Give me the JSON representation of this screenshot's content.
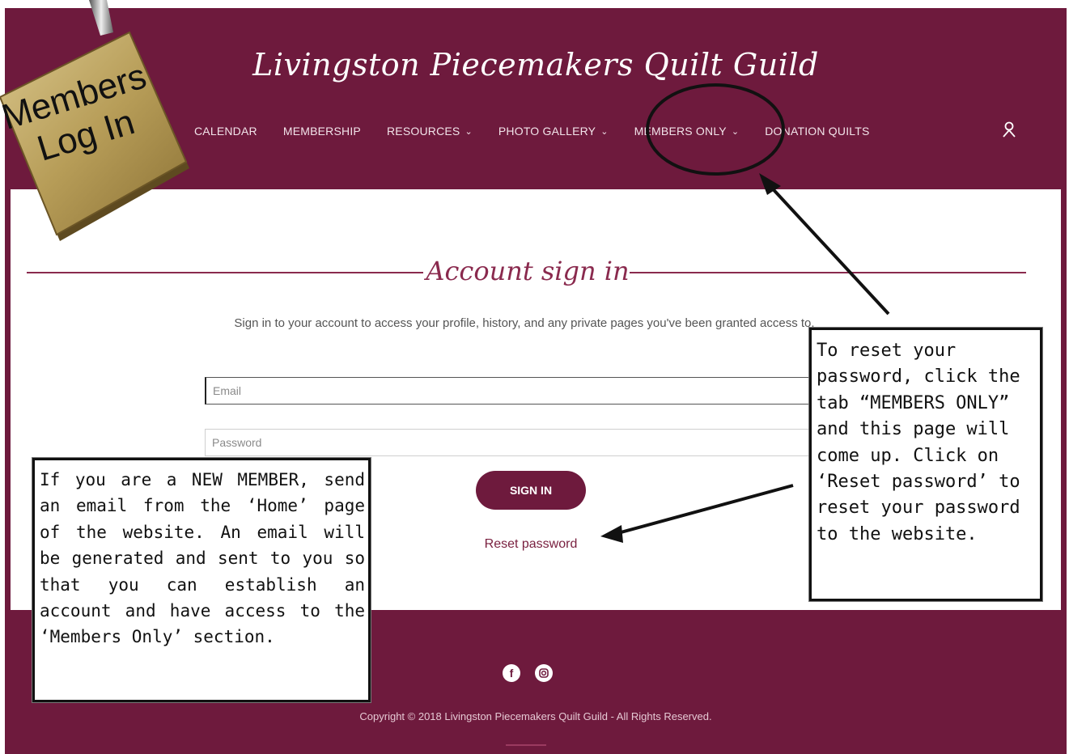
{
  "site": {
    "title": "Livingston Piecemakers Quilt Guild",
    "nav": [
      {
        "label": "CALENDAR",
        "has_dropdown": false
      },
      {
        "label": "MEMBERSHIP",
        "has_dropdown": false
      },
      {
        "label": "RESOURCES",
        "has_dropdown": true
      },
      {
        "label": "PHOTO GALLERY",
        "has_dropdown": true
      },
      {
        "label": "MEMBERS ONLY",
        "has_dropdown": true
      },
      {
        "label": "DONATION QUILTS",
        "has_dropdown": false
      }
    ],
    "account_icon": "user-icon"
  },
  "signin": {
    "title": "Account sign in",
    "intro": "Sign in to your account to access your profile, history, and any private pages you've been granted access to.",
    "email_placeholder": "Email",
    "password_placeholder": "Password",
    "button_label": "SIGN IN",
    "reset_link": "Reset password"
  },
  "footer": {
    "social": [
      "facebook-icon",
      "instagram-icon"
    ],
    "copyright": "Copyright © 2018 Livingston Piecemakers Quilt Guild - All Rights Reserved."
  },
  "overlay": {
    "lock_text_line1": "Members",
    "lock_text_line2": "Log In",
    "callout_left": "If you are a NEW MEMBER, send an email from the ‘Home’ page of the website. An email will be generated and sent to you so that you can establish an account and have access to the ‘Members Only’ section.",
    "callout_right": "To reset your password, click the tab “MEMBERS ONLY” and this page will come up. Click on ‘Reset password’ to reset your password to the website."
  },
  "colors": {
    "brand": "#6e1a3d",
    "accent": "#8a2a4e"
  }
}
